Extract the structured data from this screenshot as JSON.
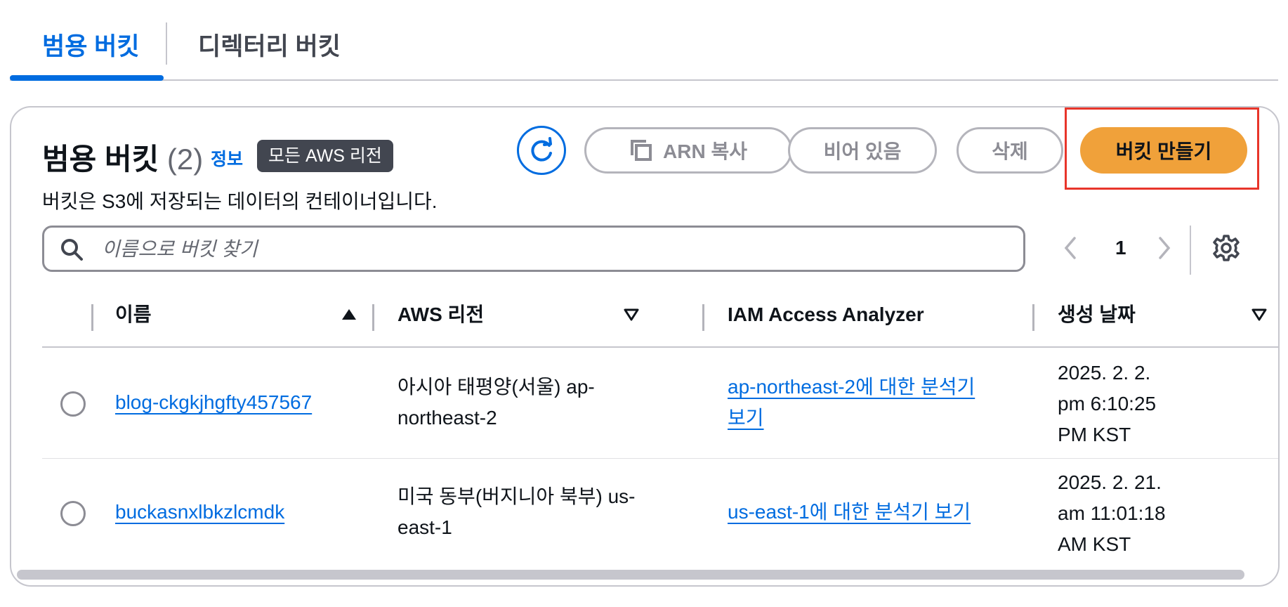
{
  "tabs": [
    {
      "label": "범용 버킷",
      "active": true
    },
    {
      "label": "디렉터리 버킷",
      "active": false
    }
  ],
  "header": {
    "title": "범용 버킷",
    "count": "(2)",
    "info_link": "정보",
    "region_badge": "모든 AWS 리전",
    "description": "버킷은 S3에 저장되는 데이터의 컨테이너입니다."
  },
  "toolbar": {
    "refresh_icon": "refresh-icon",
    "copy_arn_label": "ARN 복사",
    "empty_label": "비어 있음",
    "delete_label": "삭제",
    "create_label": "버킷 만들기"
  },
  "search": {
    "placeholder": "이름으로 버킷 찾기",
    "value": ""
  },
  "pagination": {
    "current_page": "1"
  },
  "table": {
    "columns": [
      "이름",
      "AWS 리전",
      "IAM Access Analyzer",
      "생성 날짜"
    ],
    "rows": [
      {
        "name": "blog-ckgkjhgfty457567",
        "region": [
          "아시아 태평양(서울) ap-",
          "northeast-2"
        ],
        "analyzer": [
          "ap-northeast-2에 대한 분석기",
          "보기"
        ],
        "created": [
          "2025. 2. 2.",
          "pm 6:10:25",
          "PM KST"
        ]
      },
      {
        "name": "buckasnxlbkzlcmdk",
        "region": [
          "미국 동부(버지니아 북부) us-",
          "east-1"
        ],
        "analyzer": [
          "us-east-1에 대한 분석기 보기"
        ],
        "created": [
          "2025. 2. 21.",
          "am 11:01:18",
          "AM KST"
        ]
      }
    ]
  },
  "colors": {
    "accent": "#006ce0",
    "primary_button": "#f0a13a",
    "highlight_border": "#e8352a",
    "disabled_text": "#8c8c94"
  }
}
